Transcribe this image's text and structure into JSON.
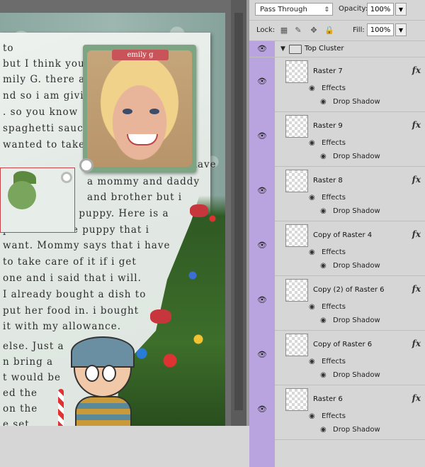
{
  "canvas": {
    "text_lines": [
      "to",
      "but I think you",
      "mily G. there are",
      "nd so i am giving",
      ". so you know",
      "spaghetti sauce",
      "wanted to take a",
      "i am 6 years old. i have",
      "a mommy and daddy",
      "and brother but i",
      "really want a puppy. Here is a",
      "picture of the puppy that i",
      "want. Mommy says that i have",
      "to take care of it if i get",
      "one and i said that i will.",
      "I already bought a dish to",
      "put her food in. i bought",
      "it with my allowance.",
      "else. Just a",
      "n bring a",
      "t would be",
      "ed the",
      "on the",
      "e set"
    ],
    "photo_tag": "emily g"
  },
  "layers_panel": {
    "blend_mode": "Pass Through",
    "opacity_label": "Opacity:",
    "opacity_value": "100%",
    "lock_label": "Lock:",
    "fill_label": "Fill:",
    "fill_value": "100%",
    "group_name": "Top Cluster",
    "effects_label": "Effects",
    "drop_shadow_label": "Drop Shadow",
    "fx_label": "fx",
    "layers": [
      {
        "name": "Raster 7"
      },
      {
        "name": "Raster 9"
      },
      {
        "name": "Raster 8"
      },
      {
        "name": "Copy of Raster 4"
      },
      {
        "name": "Copy (2) of Raster 6"
      },
      {
        "name": "Copy of Raster 6"
      },
      {
        "name": "Raster 6"
      }
    ]
  },
  "colors": {
    "visibility_column": "#b9a4e0",
    "panel_bg": "#d6d6d6",
    "tag": "#c8545a"
  },
  "icons": [
    "eye-icon",
    "lock-transparent-icon",
    "lock-paint-icon",
    "lock-move-icon",
    "lock-all-icon",
    "folder-icon",
    "collapse-arrow-icon",
    "dropdown-arrow-icon",
    "fx-icon"
  ]
}
